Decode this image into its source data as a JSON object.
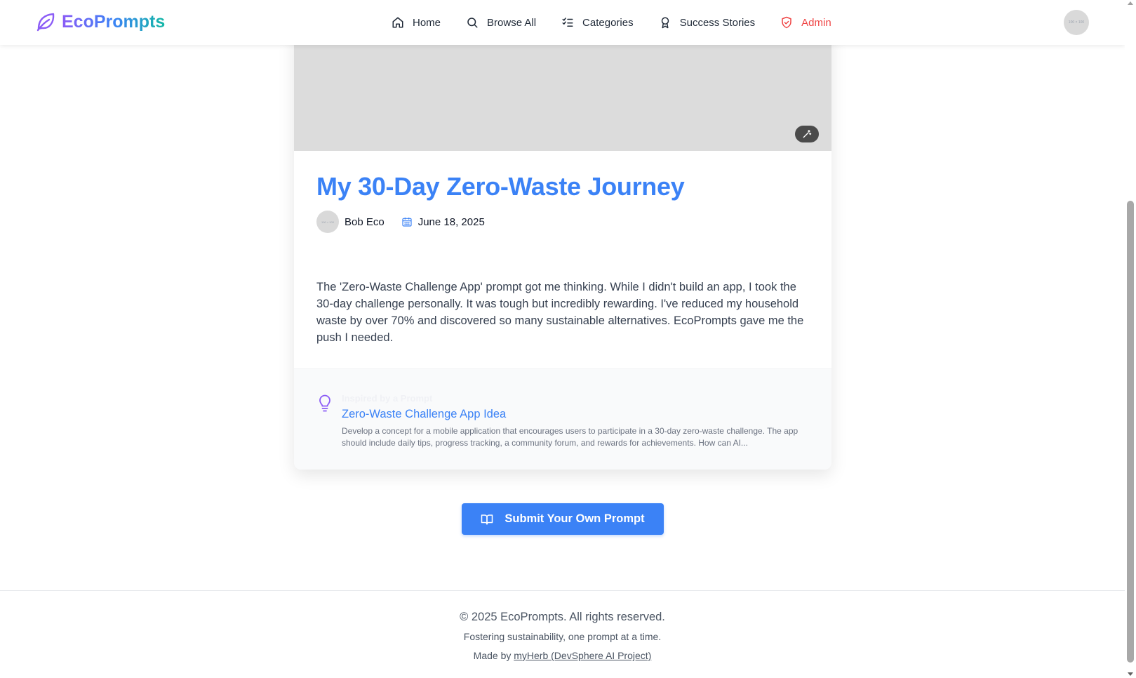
{
  "header": {
    "brand": "EcoPrompts",
    "nav": [
      {
        "label": "Home",
        "icon": "home-icon"
      },
      {
        "label": "Browse All",
        "icon": "search-icon"
      },
      {
        "label": "Categories",
        "icon": "list-checks-icon"
      },
      {
        "label": "Success Stories",
        "icon": "award-icon"
      },
      {
        "label": "Admin",
        "icon": "shield-check-icon"
      }
    ],
    "avatar_text": "100 × 100"
  },
  "story": {
    "title": "My 30-Day Zero-Waste Journey",
    "author": "Bob Eco",
    "author_avatar_text": "100 × 100",
    "date": "June 18, 2025",
    "body": "The 'Zero-Waste Challenge App' prompt got me thinking. While I didn't build an app, I took the 30-day challenge personally. It was tough but incredibly rewarding. I've reduced my household waste by over 70% and discovered so many sustainable alternatives. EcoPrompts gave me the push I needed."
  },
  "inspired": {
    "label": "Inspired by a Prompt",
    "prompt_title": "Zero-Waste Challenge App Idea",
    "prompt_description": "Develop a concept for a mobile application that encourages users to participate in a 30-day zero-waste challenge. The app should include daily tips, progress tracking, a community forum, and rewards for achievements. How can AI..."
  },
  "cta": {
    "label": "Submit Your Own Prompt"
  },
  "footer": {
    "copyright": "© 2025 EcoPrompts. All rights reserved.",
    "tagline": "Fostering sustainability, one prompt at a time.",
    "made_by_prefix": "Made by ",
    "made_by_link": "myHerb (DevSphere AI Project)"
  },
  "colors": {
    "accent": "#3b82f6",
    "admin": "#ef4444",
    "brand_gradient": [
      "#8b5cf6",
      "#3b82f6",
      "#14b8a6"
    ],
    "bulb": "#8b5cf6"
  }
}
